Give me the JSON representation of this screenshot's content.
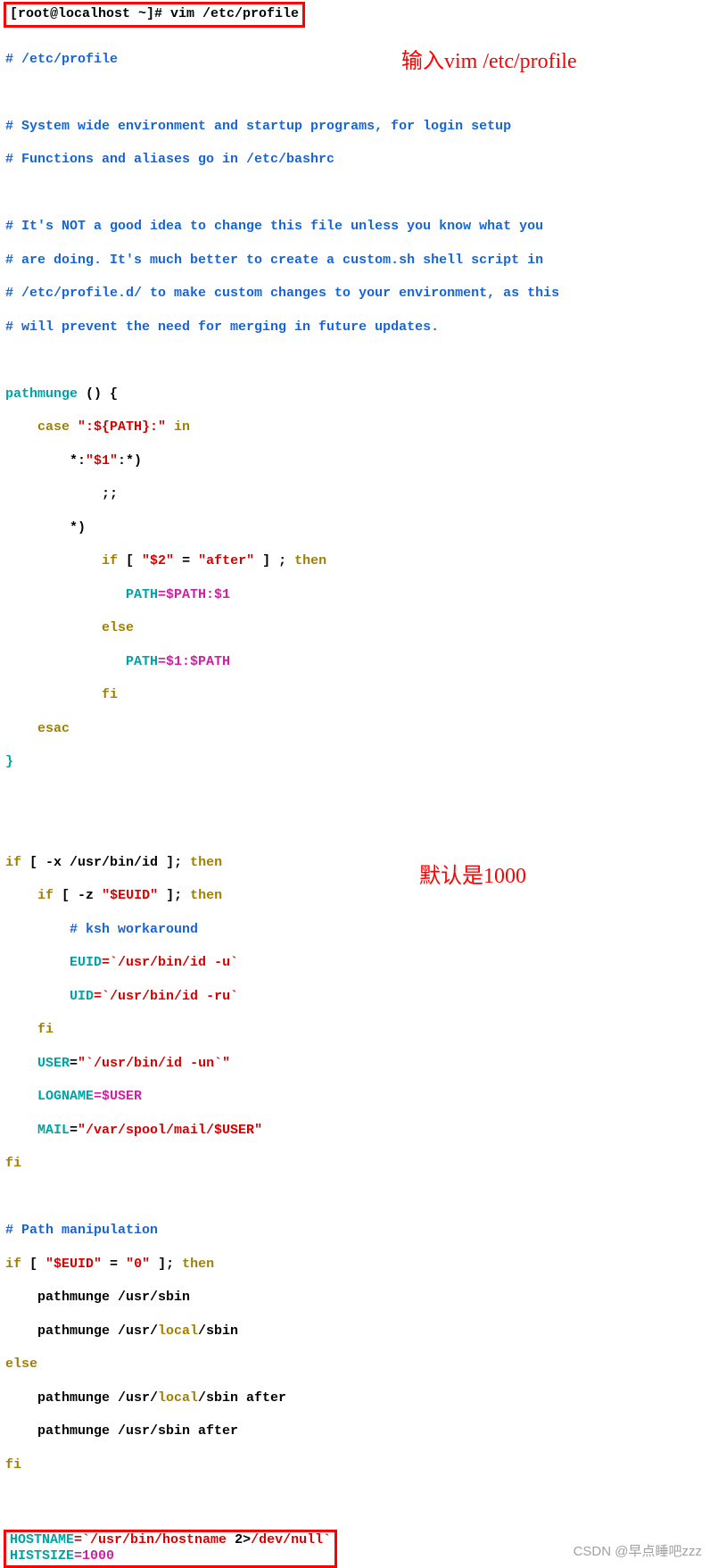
{
  "prompt": "[root@localhost ~]#  vim /etc/profile",
  "annot1": "输入vim /etc/profile",
  "annot2": "默认是1000",
  "watermark": "CSDN @早点睡吧zzz",
  "c": {
    "l1": "# /etc/profile",
    "l2": "# System wide environment and startup programs, for login setup",
    "l3": "# Functions and aliases go in /etc/bashrc",
    "l4": "# It's NOT a good idea to change this file unless you know what you",
    "l5": "# are doing. It's much better to create a custom.sh shell script in",
    "l6": "# /etc/profile.d/ to make custom changes to your environment, as this",
    "l7": "# will prevent the need for merging in future updates.",
    "pm": "pathmunge ",
    "par": "() {",
    "case": "    case ",
    "caseq": "\":${PATH}:\"",
    "in": " in",
    "p1": "        *:",
    "p1b": "\"$1\"",
    "p1c": ":*)",
    "semisemi": "            ;;",
    "star": "        *)",
    "if1a": "            if ",
    "if1b": "[ ",
    "if1c": "\"$2\"",
    "if1d": " = ",
    "if1e": "\"after\"",
    "if1f": " ] ",
    "if1g": "; ",
    "if1h": "then",
    "pa1a": "               PATH",
    "pa1b": "=$PATH:$1",
    "else1": "            else",
    "pa2a": "               PATH",
    "pa2b": "=$1:$PATH",
    "fi1": "            fi",
    "esac": "    esac",
    "brace": "}",
    "if2a": "if",
    "if2b": " [ -x ",
    "if2c": "/usr/bin/id",
    "if2d": " ]",
    "if2e": "; ",
    "if2f": "then",
    "if3a": "    if",
    "if3b": " [ ",
    "if3c": "-z",
    "if3d": " ",
    "if3e": "\"$EUID\"",
    "if3f": " ]",
    "if3g": "; ",
    "if3h": "then",
    "ksh": "        # ksh workaround",
    "euid_a": "        EUID",
    "euid_b": "=`",
    "euid_c": "/usr/bin/id -u",
    "euid_d": "`",
    "uid_a": "        UID",
    "uid_b": "=`",
    "uid_c": "/usr/bin/id -ru",
    "uid_d": "`",
    "fi2": "    fi",
    "user_a": "    USER",
    "user_b": "=",
    "user_c": "\"`",
    "user_d": "/usr/bin/id -un",
    "user_e": "`\"",
    "log_a": "    LOGNAME",
    "log_b": "=$USER",
    "mail_a": "    MAIL",
    "mail_b": "=",
    "mail_c": "\"/var/spool/mail/$USER\"",
    "fi3": "fi",
    "pm_hdr": "# Path manipulation",
    "if4a": "if",
    "if4b": " [ ",
    "if4c": "\"$EUID\"",
    "if4d": " = ",
    "if4e": "\"0\"",
    "if4f": " ]",
    "if4g": "; ",
    "if4h": "then",
    "pm1a": "    pathmunge /usr",
    "pm1b": "/sbin",
    "pm2a": "    pathmunge /usr/",
    "pm2b": "local",
    "pm2c": "/sbin",
    "else2": "else",
    "pm3a": "    pathmunge /usr/",
    "pm3b": "local",
    "pm3c": "/sbin after",
    "pm4a": "    pathmunge /usr",
    "pm4b": "/sbin after",
    "fi4": "fi",
    "hn_a": "HOSTNAME",
    "hn_b": "=`",
    "hn_c": "/usr/bin/hostname ",
    "hn_d": "2",
    "hn_e": ">",
    "hn_f": "/dev/null",
    "hn_g": "`",
    "hs_a": "HISTSIZE",
    "hs_b": "=1000"
  }
}
